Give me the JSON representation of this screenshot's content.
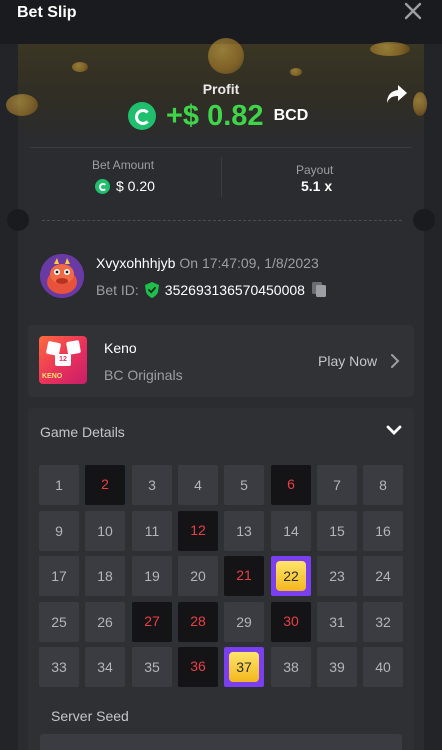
{
  "header": {
    "title": "Bet Slip",
    "close_icon": "close-icon"
  },
  "profit": {
    "label": "Profit",
    "value": "+$ 0.82",
    "currency": "BCD",
    "accent": "#3fd44a"
  },
  "bet_amount": {
    "label": "Bet Amount",
    "value": "$ 0.20"
  },
  "payout": {
    "label": "Payout",
    "value": "5.1 x"
  },
  "user": {
    "name": "Xvyxohhhjyb",
    "time": "On 17:47:09, 1/8/2023",
    "bet_id_label": "Bet ID:",
    "bet_id": "352693136570450008"
  },
  "game": {
    "name": "Keno",
    "provider": "BC Originals",
    "play_label": "Play Now",
    "thumb_tag": "KENO",
    "thumb_number": "12"
  },
  "details": {
    "title": "Game Details",
    "numbers": [
      "1",
      "2",
      "3",
      "4",
      "5",
      "6",
      "7",
      "8",
      "9",
      "10",
      "11",
      "12",
      "13",
      "14",
      "15",
      "16",
      "17",
      "18",
      "19",
      "20",
      "21",
      "22",
      "23",
      "24",
      "25",
      "26",
      "27",
      "28",
      "29",
      "30",
      "31",
      "32",
      "33",
      "34",
      "35",
      "36",
      "37",
      "38",
      "39",
      "40"
    ],
    "picked": [
      "2",
      "6",
      "12",
      "21",
      "27",
      "28",
      "30",
      "36"
    ],
    "hits": [
      "22",
      "37"
    ],
    "server_seed_label": "Server Seed"
  }
}
